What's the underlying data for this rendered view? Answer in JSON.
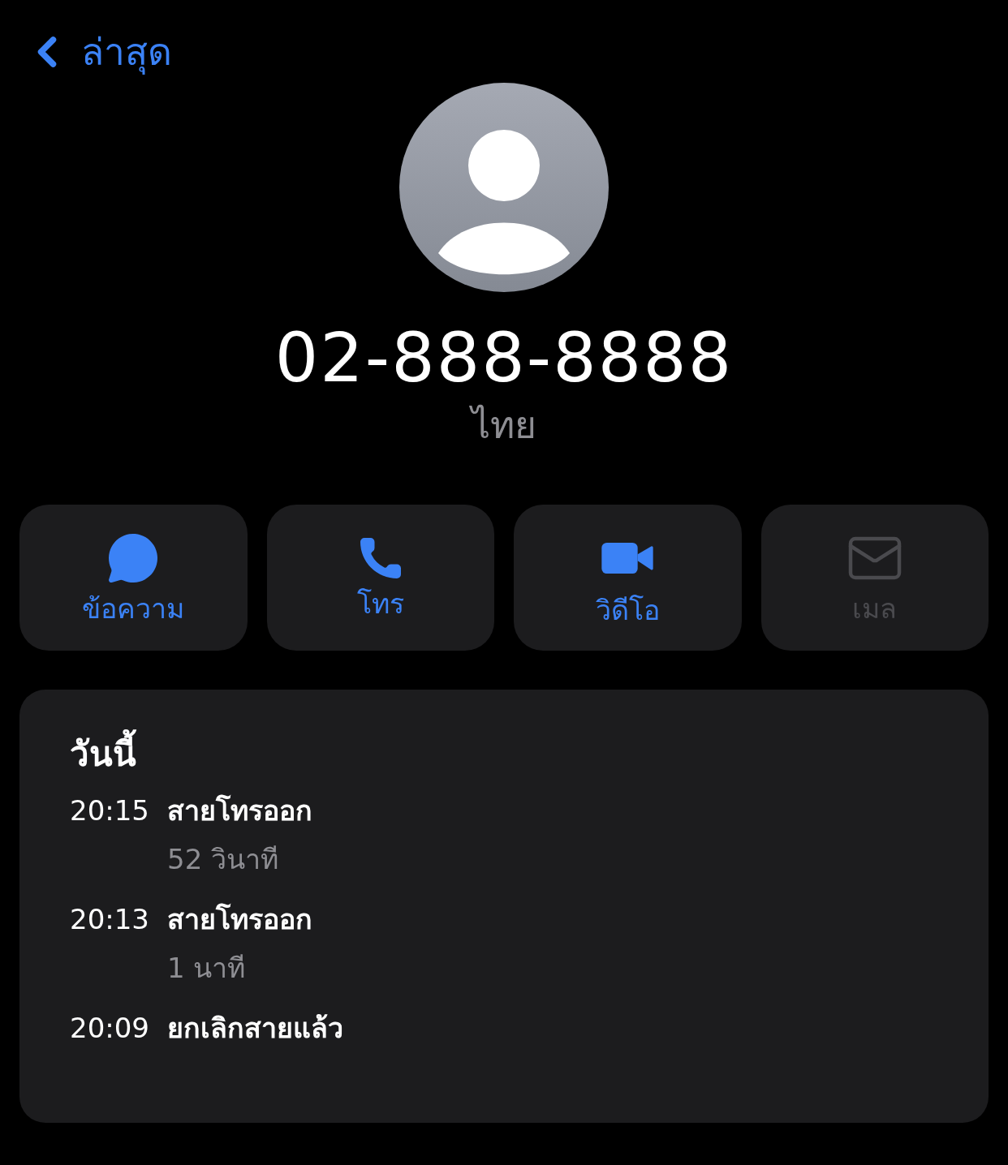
{
  "nav": {
    "back_label": "ล่าสุด"
  },
  "contact": {
    "number": "02-888-8888",
    "label": "ไทย"
  },
  "actions": [
    {
      "kind": "message",
      "label": "ข้อความ",
      "disabled": false
    },
    {
      "kind": "call",
      "label": "โทร",
      "disabled": false
    },
    {
      "kind": "video",
      "label": "วิดีโอ",
      "disabled": false
    },
    {
      "kind": "mail",
      "label": "เมล",
      "disabled": true
    }
  ],
  "history": {
    "heading": "วันนี้",
    "calls": [
      {
        "time": "20:15",
        "type": "สายโทรออก",
        "duration": "52 วินาที"
      },
      {
        "time": "20:13",
        "type": "สายโทรออก",
        "duration": "1 นาที"
      },
      {
        "time": "20:09",
        "type": "ยกเลิกสายแล้ว"
      }
    ]
  }
}
